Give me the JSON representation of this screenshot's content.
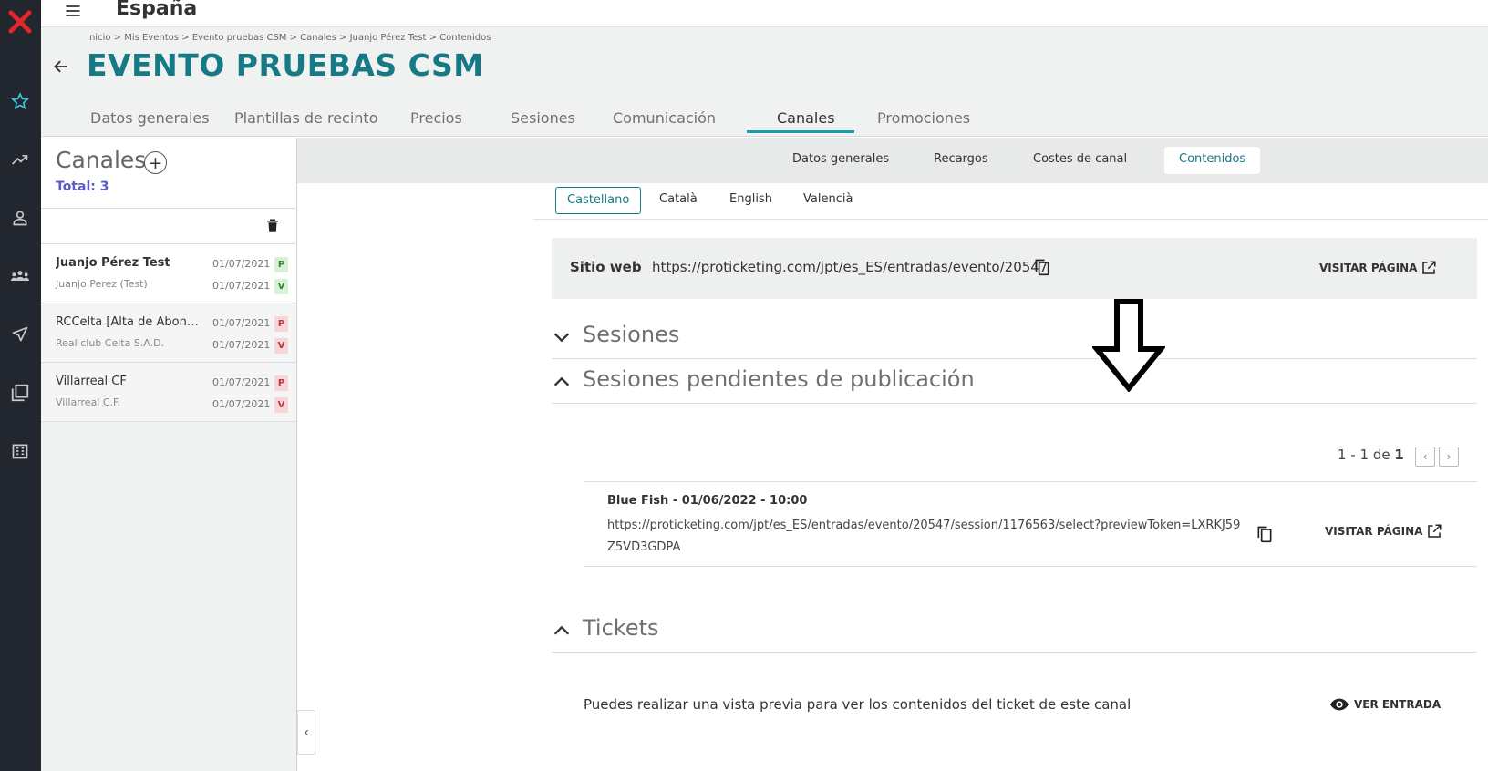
{
  "app": {
    "region": "España"
  },
  "breadcrumb": "Inicio > Mis Eventos > Evento pruebas CSM > Canales > Juanjo Pérez Test > Contenidos",
  "page_title": "EVENTO PRUEBAS CSM",
  "tabs": [
    {
      "label": "Datos generales"
    },
    {
      "label": "Plantillas de recinto"
    },
    {
      "label": "Precios"
    },
    {
      "label": "Sesiones"
    },
    {
      "label": "Comunicación"
    },
    {
      "label": "Canales",
      "active": true
    },
    {
      "label": "Promociones"
    }
  ],
  "channels_panel": {
    "title": "Canales",
    "total": "Total: 3",
    "items": [
      {
        "name": "Juanjo Pérez Test",
        "sub": "Juanjo Perez (Test)",
        "date1": "01/07/2021",
        "badge1": "P",
        "date2": "01/07/2021",
        "badge2": "V"
      },
      {
        "name": "RCCelta [Alta de Abonados]",
        "sub": "Real club Celta S.A.D.",
        "date1": "01/07/2021",
        "badge1": "P",
        "date2": "01/07/2021",
        "badge2": "V"
      },
      {
        "name": "Villarreal CF",
        "sub": "Villarreal C.F.",
        "date1": "01/07/2021",
        "badge1": "P",
        "date2": "01/07/2021",
        "badge2": "V"
      }
    ]
  },
  "subtabs": [
    {
      "label": "Datos generales"
    },
    {
      "label": "Recargos"
    },
    {
      "label": "Costes de canal"
    },
    {
      "label": "Contenidos",
      "active": true
    }
  ],
  "languages": [
    {
      "label": "Castellano",
      "active": true
    },
    {
      "label": "Català"
    },
    {
      "label": "English"
    },
    {
      "label": "Valencià"
    }
  ],
  "website": {
    "label": "Sitio web",
    "url": "https://proticketing.com/jpt/es_ES/entradas/evento/20547",
    "visit_label": "VISITAR PÁGINA"
  },
  "sections": {
    "sessions": "Sesiones",
    "pending": "Sesiones pendientes de publicación",
    "tickets": "Tickets"
  },
  "pager": {
    "range": "1 - 1",
    "of": "de",
    "total": "1"
  },
  "pending_session": {
    "title": "Blue Fish - 01/06/2022 - 10:00",
    "url": "https://proticketing.com/jpt/es_ES/entradas/evento/20547/session/1176563/select?previewToken=LXRKJ59Z5VD3GDPA",
    "visit_label": "VISITAR PÁGINA"
  },
  "tickets": {
    "text": "Puedes realizar una vista previa para ver los contenidos del ticket de este canal",
    "button": "VER ENTRADA"
  },
  "colors": {
    "accent": "#157a85",
    "rail": "#22262e",
    "total": "#5a5ac8"
  }
}
